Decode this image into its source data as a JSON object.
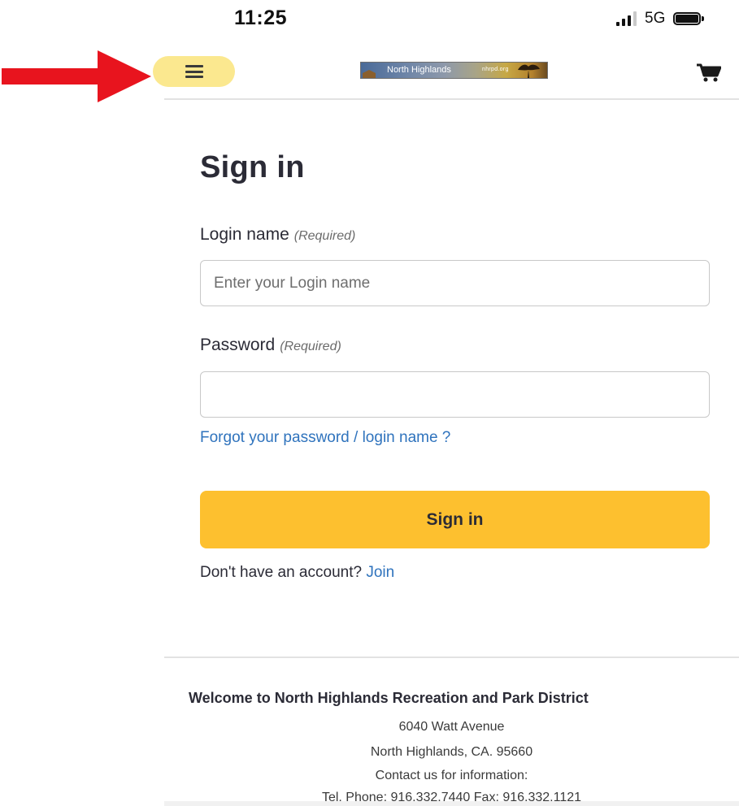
{
  "status_bar": {
    "time": "11:25",
    "network": "5G",
    "icons": [
      "signal-icon",
      "battery-icon"
    ]
  },
  "header": {
    "menu_icon": "hamburger-menu-icon",
    "logo_text": "North Highlands",
    "logo_url": "nhrpd.org",
    "cart_icon": "shopping-cart-icon",
    "annotation_icon": "red-arrow-icon",
    "colors": {
      "menu_highlight": "#fbe88f",
      "annotation": "#e8141e"
    }
  },
  "form": {
    "title": "Sign in",
    "login_label": "Login name",
    "login_required": "(Required)",
    "login_placeholder": "Enter your Login name",
    "login_value": "",
    "password_label": "Password",
    "password_required": "(Required)",
    "password_value": "",
    "forgot_link": "Forgot your password / login name ?",
    "submit_label": "Sign in",
    "no_account_text": "Don't have an account?",
    "join_link": "Join",
    "colors": {
      "button": "#fdc02f",
      "link": "#2f73bd"
    }
  },
  "footer": {
    "welcome": "Welcome to North Highlands Recreation and Park District",
    "address_line1": "6040 Watt Avenue",
    "address_line2": "North Highlands, CA. 95660",
    "contact": "Contact us for information:",
    "phone": "Tel. Phone: 916.332.7440 Fax: 916.332.1121"
  }
}
